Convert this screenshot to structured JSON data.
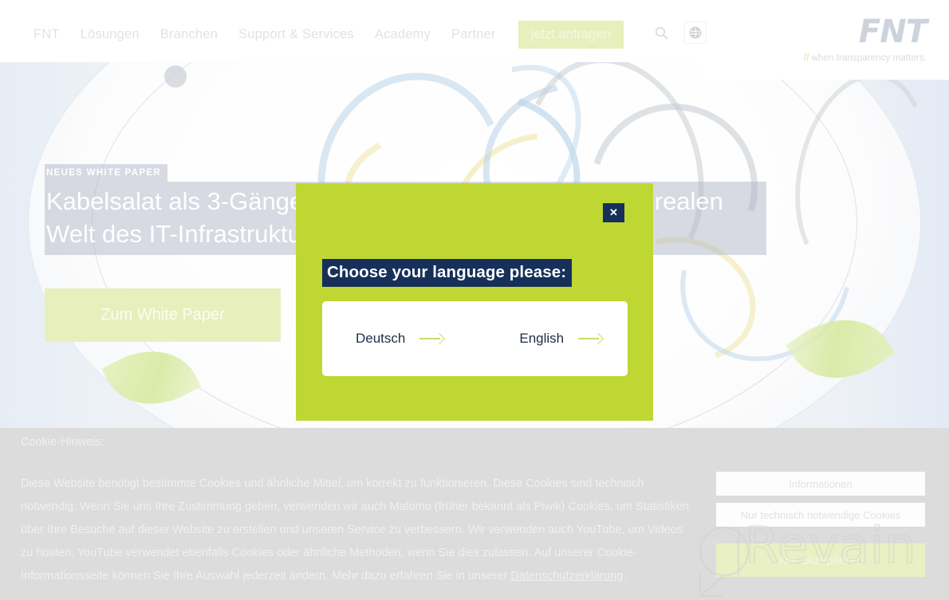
{
  "header": {
    "nav_items": [
      {
        "label": "FNT"
      },
      {
        "label": "Lösungen"
      },
      {
        "label": "Branchen"
      },
      {
        "label": "Support & Services"
      },
      {
        "label": "Academy"
      },
      {
        "label": "Partner"
      }
    ],
    "cta_label": "jetzt anfragen",
    "search_icon": "search-icon",
    "language_icon": "globe-icon",
    "logo_text": "FNT",
    "logo_tagline": "when transparency matters.",
    "logo_tagline_prefix": "//"
  },
  "hero": {
    "kicker": "NEUES WHITE PAPER",
    "title": "Kabelsalat als 3-Gänge Menü: Worst Practices aus der realen Welt des IT-Infrastrukturmanagements",
    "button_label": "Zum White Paper"
  },
  "language_modal": {
    "heading": "Choose your language please:",
    "close_label": "✕",
    "close_icon": "close-icon",
    "options": [
      {
        "label": "Deutsch",
        "arrow_icon": "arrow-right-icon"
      },
      {
        "label": "English",
        "arrow_icon": "arrow-right-icon"
      }
    ],
    "background_color": "#bed733",
    "heading_background_color": "#16305a"
  },
  "cookie_banner": {
    "title": "Cookie-Hinweis:",
    "body_before_link": "Diese Website benötigt bestimmte Cookies und ähnliche Mittel, um korrekt zu funktionieren. Diese Cookies sind technisch notwendig. Wenn Sie uns Ihre Zustimmung geben, verwenden wir auch Matomo (früher bekannt als Piwik) Cookies, um Statistiken über Ihre Besuche auf dieser Website zu erstellen und unseren Service zu verbessern. Wir verwenden auch YouTube, um Videos zu hosten. YouTube verwendet ebenfalls Cookies oder ähnliche Methoden, wenn Sie dies zulassen. Auf unserer Cookie-Informationsseite können Sie Ihre Auswahl jederzeit ändern. Mehr dazu erfahren Sie in unserer ",
    "link_label": "Datenschutzerklärung",
    "body_after_link": ".",
    "buttons": {
      "info_label": "Informationen",
      "essential_label": "Nur technisch notwendige Cookies",
      "accept_label": "Alle akzeptieren"
    }
  },
  "watermark": {
    "text": "Revain"
  }
}
